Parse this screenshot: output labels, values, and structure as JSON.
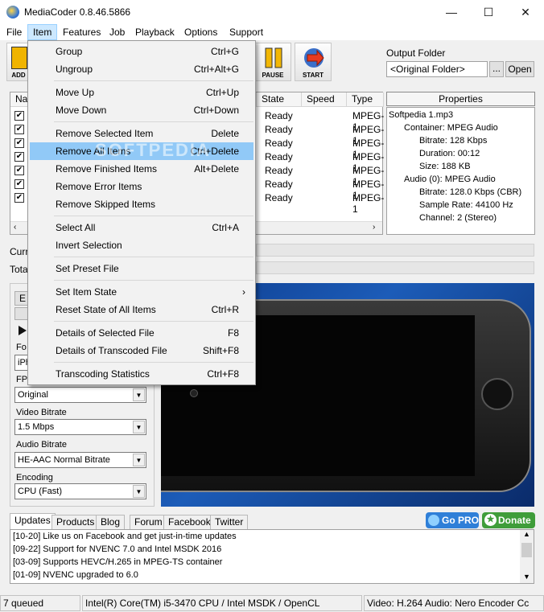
{
  "window": {
    "title": "MediaCoder 0.8.46.5866",
    "minimize": "—",
    "maximize": "☐",
    "close": "✕"
  },
  "menubar": [
    "File",
    "Item",
    "Features",
    "Job",
    "Playback",
    "Options",
    "Support"
  ],
  "toolbar": {
    "add": "ADD",
    "pause": "PAUSE",
    "start": "START"
  },
  "output_folder": {
    "label": "Output Folder",
    "value": "<Original Folder>",
    "browse": "...",
    "open": "Open"
  },
  "file_list": {
    "headers": {
      "name": "Nar",
      "state": "State",
      "speed": "Speed",
      "type": "Type"
    },
    "rows": [
      {
        "state": "Ready",
        "type": "MPEG-1"
      },
      {
        "state": "Ready",
        "type": "MPEG-1"
      },
      {
        "state": "Ready",
        "type": "MPEG-1"
      },
      {
        "state": "Ready",
        "type": "MPEG-1"
      },
      {
        "state": "Ready",
        "type": "MPEG-1"
      },
      {
        "state": "Ready",
        "type": "MPEG-1"
      },
      {
        "state": "Ready",
        "type": "MPEG-1"
      }
    ]
  },
  "properties": {
    "header": "Properties",
    "file": "Softpedia 1.mp3",
    "container": "Container: MPEG Audio",
    "bitrate": "Bitrate: 128 Kbps",
    "duration": "Duration: 00:12",
    "size": "Size: 188 KB",
    "audio": "Audio (0): MPEG Audio",
    "a_bitrate": "Bitrate: 128.0 Kbps (CBR)",
    "sample_rate": "Sample Rate: 44100 Hz",
    "channel": "Channel: 2 (Stereo)"
  },
  "progress": {
    "current": "Curr",
    "total": "Tota"
  },
  "left_panel": {
    "format_label": "Fo",
    "format_value": "iPh",
    "fps_label": "FPS",
    "fps_value": "Original",
    "video_bitrate_label": "Video Bitrate",
    "video_bitrate_value": "1.5 Mbps",
    "audio_bitrate_label": "Audio Bitrate",
    "audio_bitrate_value": "HE-AAC Normal Bitrate",
    "encoding_label": "Encoding",
    "encoding_value": "CPU (Fast)",
    "btn_e": "E"
  },
  "item_menu": {
    "group": "Group",
    "group_sc": "Ctrl+G",
    "ungroup": "Ungroup",
    "ungroup_sc": "Ctrl+Alt+G",
    "move_up": "Move Up",
    "move_up_sc": "Ctrl+Up",
    "move_down": "Move Down",
    "move_down_sc": "Ctrl+Down",
    "remove_selected": "Remove Selected Item",
    "remove_selected_sc": "Delete",
    "remove_all": "Remove All Items",
    "remove_all_sc": "Ctrl+Delete",
    "remove_finished": "Remove Finished Items",
    "remove_finished_sc": "Alt+Delete",
    "remove_error": "Remove Error Items",
    "remove_skipped": "Remove Skipped Items",
    "select_all": "Select All",
    "select_all_sc": "Ctrl+A",
    "invert": "Invert Selection",
    "set_preset": "Set Preset File",
    "set_state": "Set Item State",
    "set_state_arrow": "›",
    "reset_state": "Reset State of All Items",
    "reset_state_sc": "Ctrl+R",
    "details_selected": "Details of Selected File",
    "details_selected_sc": "F8",
    "details_transcoded": "Details of Transcoded File",
    "details_transcoded_sc": "Shift+F8",
    "stats": "Transcoding Statistics",
    "stats_sc": "Ctrl+F8"
  },
  "watermark": "SOFTPEDIA",
  "tabs": [
    "Updates",
    "Products",
    "Blog",
    "Forum",
    "Facebook",
    "Twitter"
  ],
  "promo": {
    "gopro": "Go PRO",
    "donate": "Donate"
  },
  "news": [
    "[10-20] Like us on Facebook and get just-in-time updates",
    "[09-22] Support for NVENC 7.0 and Intel MSDK 2016",
    "[03-09] Supports HEVC/H.265 in MPEG-TS container",
    "[01-09] NVENC upgraded to 6.0"
  ],
  "statusbar": {
    "queued": "7 queued",
    "cpu": "Intel(R) Core(TM) i5-3470 CPU  / Intel MSDK / OpenCL",
    "codecs": "Video: H.264  Audio: Nero Encoder  Cc"
  },
  "colors": {
    "accent": "#91c9f7",
    "gopro": "#2f7fd8",
    "donate": "#3f9d3a"
  }
}
